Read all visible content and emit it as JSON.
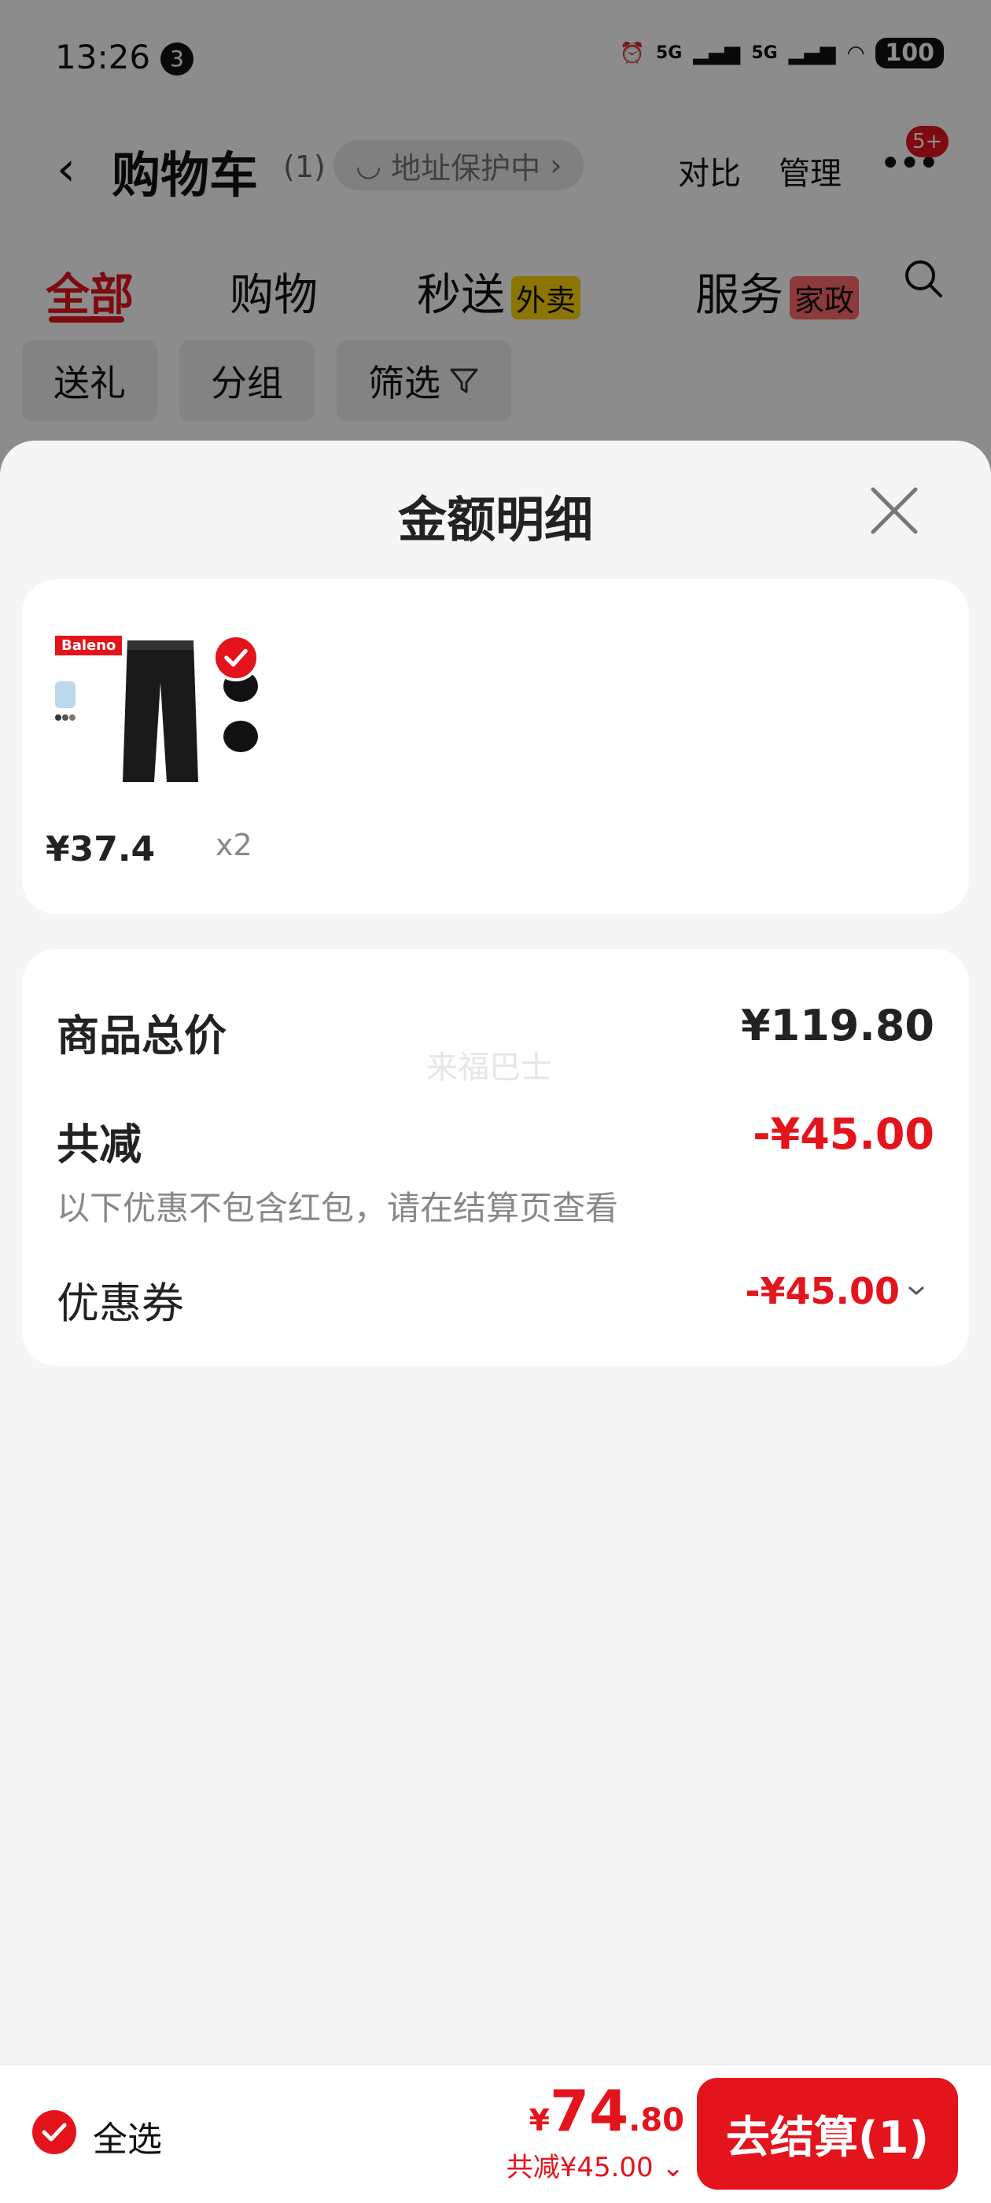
{
  "status_bar": {
    "time": "13:26",
    "notif_count": "3",
    "signal1": "5G",
    "signal2": "5G",
    "battery": "100"
  },
  "header": {
    "title": "购物车",
    "count": "(1)",
    "address_chip": "地址保护中",
    "compare": "对比",
    "manage": "管理",
    "more_badge": "5+"
  },
  "tabs": [
    {
      "label": "全部",
      "active": true
    },
    {
      "label": "购物"
    },
    {
      "label": "秒送",
      "tag": "外卖"
    },
    {
      "label": "服务",
      "tag": "家政"
    }
  ],
  "chips": [
    "送礼",
    "分组",
    "筛选"
  ],
  "sheet": {
    "title": "金额明细",
    "product": {
      "brand": "Baleno",
      "price": "¥37.4",
      "qty": "x2"
    },
    "summary": {
      "total_label": "商品总价",
      "total_value": "¥119.80",
      "reduce_label": "共减",
      "reduce_value": "-¥45.00",
      "note": "以下优惠不包含红包，请在结算页查看",
      "coupon_label": "优惠券",
      "coupon_value": "-¥45.00",
      "watermark": "来福巴士"
    }
  },
  "bottom": {
    "select_all": "全选",
    "total_currency": "¥",
    "total_int": "74",
    "total_dec": ".80",
    "saved": "共减¥45.00",
    "checkout": "去结算(1)"
  },
  "colors": {
    "accent": "#e4141c",
    "tag_yellow": "#ffd500"
  }
}
